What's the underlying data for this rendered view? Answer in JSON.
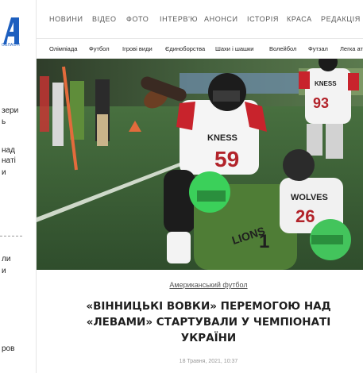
{
  "brand": {
    "logo_letter": "A",
    "logo_sub": "ОБЛАСТІ",
    "accent": "#1d5fbf"
  },
  "sidebar": {
    "fragments": [
      "зери",
      "ь",
      "над",
      "нaті",
      "и",
      "ли",
      "и",
      "ров"
    ]
  },
  "topnav": {
    "items": [
      "НОВИНИ",
      "ВІДЕО",
      "ФОТО",
      "ІНТЕРВ'Ю",
      "АНОНСИ",
      "ІСТОРІЯ",
      "КРАСА",
      "РЕДАКЦІЯ"
    ]
  },
  "subnav": {
    "items": [
      "Олімпіада",
      "Футбол",
      "Ігрові види",
      "Єдиноборства",
      "Шахи і шашки",
      "Волейбол",
      "Футзал",
      "Легка ат"
    ]
  },
  "photo": {
    "jersey_numbers": [
      "59",
      "93",
      "1",
      "26"
    ],
    "jersey_text": [
      "KNESS",
      "KNESS",
      "LIONS",
      "WOLVES"
    ]
  },
  "article": {
    "category": "Американський футбол",
    "title_lines": [
      "«ВІННИЦЬКІ ВОВКИ» ПЕРЕМОГОЮ НАД",
      "«ЛЕВАМИ» СТАРТУВАЛИ У ЧЕМПІОНАТІ",
      "УКРАЇНИ"
    ],
    "date": "18 Травня, 2021, 10:37"
  }
}
